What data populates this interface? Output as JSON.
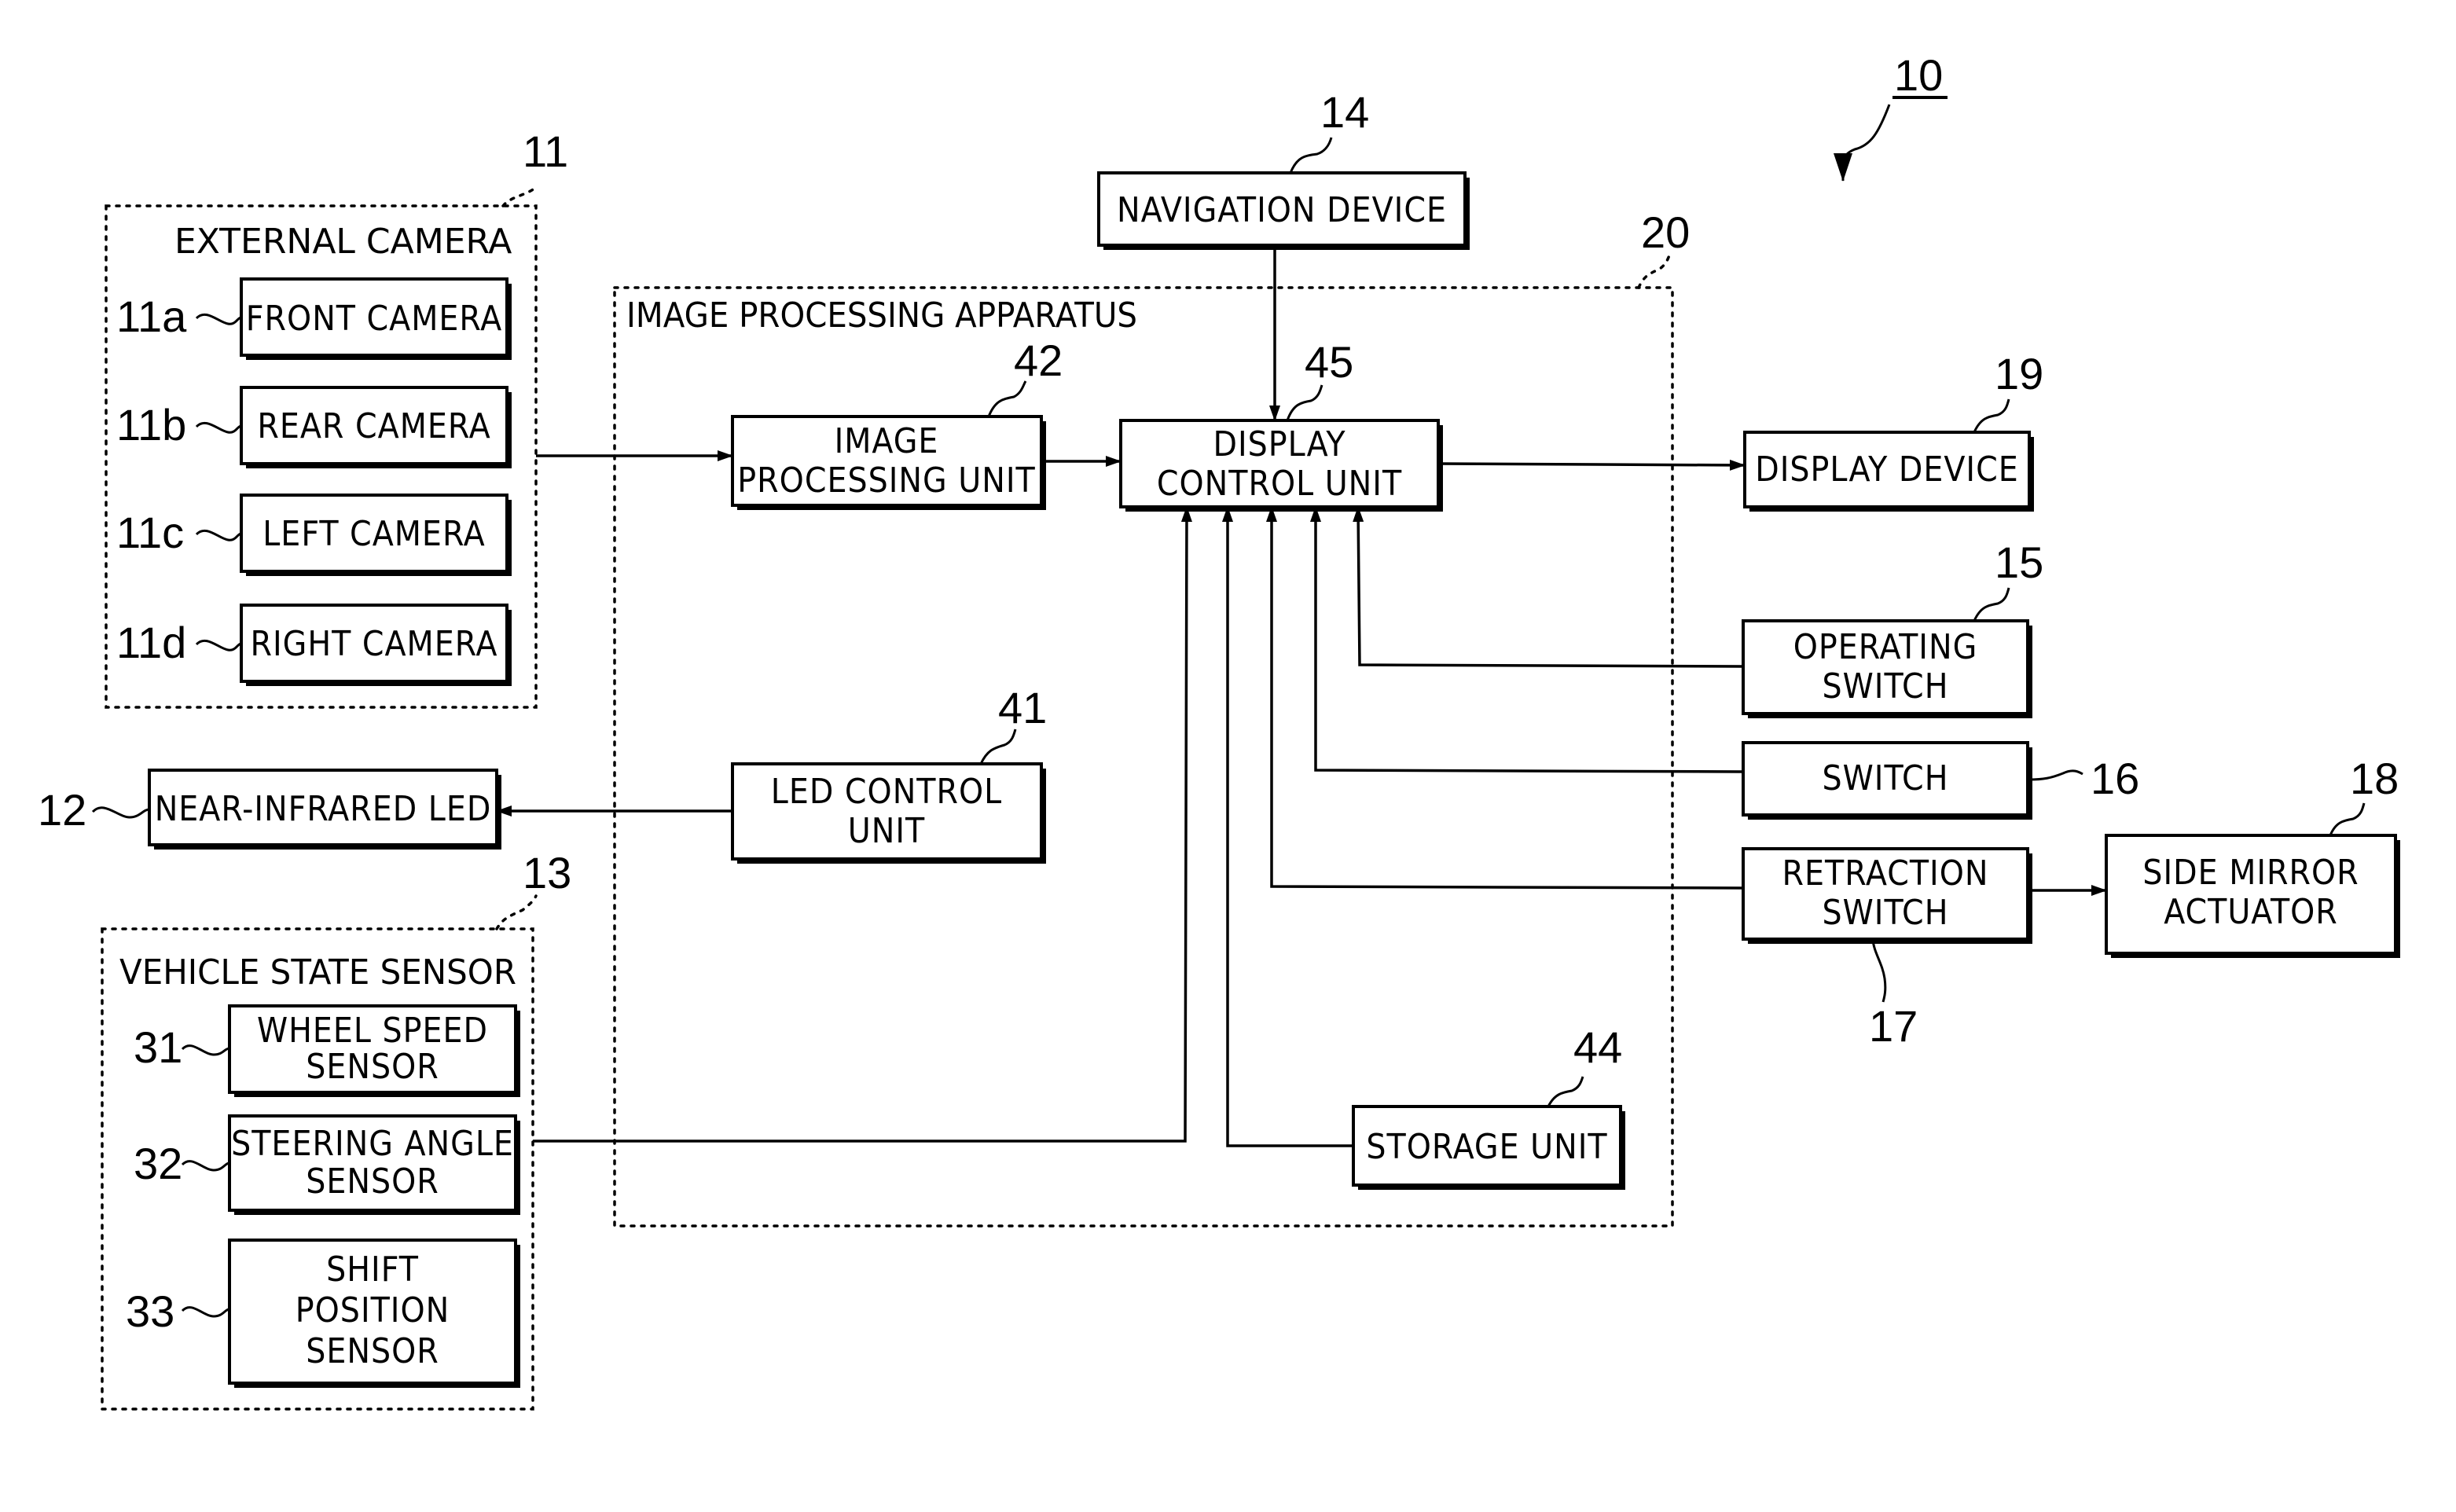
{
  "figure": {
    "reference": "10",
    "groups": {
      "external_camera": {
        "ref": "11",
        "title": "EXTERNAL CAMERA"
      },
      "vehicle_state_sensor": {
        "ref": "13",
        "title": "VEHICLE STATE SENSOR"
      },
      "image_processing_apparatus": {
        "ref": "20",
        "title": "IMAGE PROCESSING APPARATUS"
      }
    },
    "blocks": {
      "front_camera": {
        "ref": "11a",
        "lines": [
          "FRONT CAMERA"
        ]
      },
      "rear_camera": {
        "ref": "11b",
        "lines": [
          "REAR CAMERA"
        ]
      },
      "left_camera": {
        "ref": "11c",
        "lines": [
          "LEFT CAMERA"
        ]
      },
      "right_camera": {
        "ref": "11d",
        "lines": [
          "RIGHT CAMERA"
        ]
      },
      "near_infrared_led": {
        "ref": "12",
        "lines": [
          "NEAR-INFRARED LED"
        ]
      },
      "wheel_speed_sensor": {
        "ref": "31",
        "lines": [
          "WHEEL SPEED",
          "SENSOR"
        ]
      },
      "steering_angle_sensor": {
        "ref": "32",
        "lines": [
          "STEERING ANGLE",
          "SENSOR"
        ]
      },
      "shift_position_sensor": {
        "ref": "33",
        "lines": [
          "SHIFT",
          "POSITION",
          "SENSOR"
        ]
      },
      "navigation_device": {
        "ref": "14",
        "lines": [
          "NAVIGATION DEVICE"
        ]
      },
      "image_processing_unit": {
        "ref": "42",
        "lines": [
          "IMAGE",
          "PROCESSING UNIT"
        ]
      },
      "display_control_unit": {
        "ref": "45",
        "lines": [
          "DISPLAY",
          "CONTROL UNIT"
        ]
      },
      "led_control_unit": {
        "ref": "41",
        "lines": [
          "LED CONTROL",
          "UNIT"
        ]
      },
      "storage_unit": {
        "ref": "44",
        "lines": [
          "STORAGE UNIT"
        ]
      },
      "display_device": {
        "ref": "19",
        "lines": [
          "DISPLAY DEVICE"
        ]
      },
      "operating_switch": {
        "ref": "15",
        "lines": [
          "OPERATING",
          "SWITCH"
        ]
      },
      "switch": {
        "ref": "16",
        "lines": [
          "SWITCH"
        ]
      },
      "retraction_switch": {
        "ref": "17",
        "lines": [
          "RETRACTION",
          "SWITCH"
        ]
      },
      "side_mirror_actuator": {
        "ref": "18",
        "lines": [
          "SIDE MIRROR",
          "ACTUATOR"
        ]
      }
    },
    "connections": [
      {
        "from": "external_camera",
        "to": "image_processing_unit"
      },
      {
        "from": "image_processing_unit",
        "to": "display_control_unit"
      },
      {
        "from": "navigation_device",
        "to": "display_control_unit"
      },
      {
        "from": "display_control_unit",
        "to": "display_device"
      },
      {
        "from": "led_control_unit",
        "to": "near_infrared_led"
      },
      {
        "from": "vehicle_state_sensor",
        "to": "display_control_unit"
      },
      {
        "from": "storage_unit",
        "to": "display_control_unit"
      },
      {
        "from": "retraction_switch",
        "to": "display_control_unit"
      },
      {
        "from": "switch",
        "to": "display_control_unit"
      },
      {
        "from": "operating_switch",
        "to": "display_control_unit"
      },
      {
        "from": "retraction_switch",
        "to": "side_mirror_actuator"
      }
    ]
  }
}
